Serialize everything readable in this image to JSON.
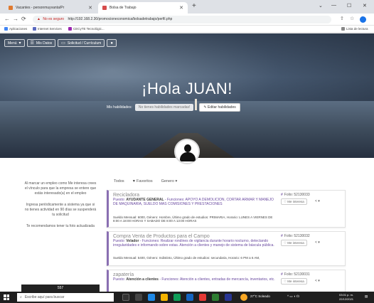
{
  "browser": {
    "tabs": [
      {
        "label": "Vacantes - personmuyvanta/Pr",
        "active": false
      },
      {
        "label": "Bolsa de Trabajo",
        "active": true
      }
    ],
    "new_tab": "+",
    "url": "http://192.168.2.30/promocioneconomica/bolsadetrabajo/perfil.php",
    "security_label": "No es seguro",
    "bookmarks": [
      "Aplicaciones",
      "Internet Services",
      "CECyTE Tecnológic..."
    ],
    "reading_list": "Lista de lectura",
    "window_controls": [
      "⌄",
      "—",
      "☐",
      "✕"
    ]
  },
  "nav": {
    "menu": "Menú",
    "mis_datos": "Mis Datos",
    "solicitud": "Solicitud / Currículum"
  },
  "hero": {
    "greeting": "¡Hola JUAN!",
    "skills_label": "Mis habilidades:",
    "skills_badge": "No tienes habilidades marcadas!",
    "skills_button": "Editar habilidades"
  },
  "sidebar": {
    "notes": [
      "Al marcar un empleo como Me interesa crees el vínculo para que la empresa se entere que estás interesado(a) en el empleo",
      "Ingresa periódicamente a sistema ya que si no tienes actividad en 90 días se suspenderá tu solicitud",
      "Te recomendamos tener tu foto actualizada"
    ],
    "bottom": "557"
  },
  "filters": {
    "all": "Todos",
    "favorites": "Favoritos",
    "genre": "Genero"
  },
  "jobs": [
    {
      "title": "Recicladora",
      "position_label": "Puesto:",
      "position": "AYUDANTE GENERAL",
      "functions": " - Funciones: APOYO A DEMOLICION, CORTAR ARMAR Y MANEJO DE MAQUINARIA, SUELDO MAS COMISIONES Y PRESTACIONES",
      "meta": "Sueldo Mensual: 6000, Género: Hombre, Último grado de estudios: PRIMARIA, Horario: LUNES A VIERNES DE 8:00 A 18:00 HORAS Y SABADO DE 8:00 A 13:00 HORAS",
      "folio": "Folio: 52130033",
      "interest": "Me interesa",
      "share": "<  ▾"
    },
    {
      "title": "Compra Venta de Productos para el Campo",
      "position_label": "Puesto:",
      "position": "Velador",
      "functions": " - Funciones: Realizar rondines de vigilancia durante horario nocturno, detectando irregularidades e informando sobre estas. Atención a clientes y manejo de sistema de báscula pública.",
      "meta": "Sueldo Mensual: 5400, Género: Indistinto, Último grado de estudios: secundaria, Horario: 6 PM a 6 AM,",
      "folio": "Folio: 52130032",
      "interest": "Me interesa",
      "share": "<  ▾"
    },
    {
      "title": "zapatería",
      "position_label": "Puesto:",
      "position": "Atención a clientes",
      "functions": " - Funciones: Atención a clientes, entradas de mercancía, inventarios, etc.",
      "meta": "",
      "folio": "Folio: 52130031",
      "interest": "Me interesa",
      "share": "<  ▾"
    }
  ],
  "taskbar": {
    "search": "Escribe aquí para buscar",
    "weather": "27°C Soleado",
    "time": "03:01 p. m.",
    "date": "22/12/2021"
  },
  "colors": {
    "accent": "#8a6fb2",
    "hero_dark": "#2c3848",
    "taskbar": "#1f1f1f"
  }
}
